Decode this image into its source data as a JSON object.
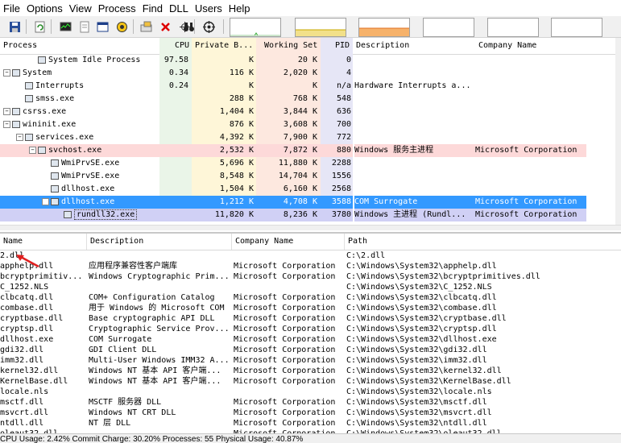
{
  "menu": [
    "File",
    "Options",
    "View",
    "Process",
    "Find",
    "DLL",
    "Users",
    "Help"
  ],
  "toolbar_icons": [
    "save-icon",
    "refresh-icon",
    "system-info-icon",
    "properties-icon",
    "window-icon",
    "cpu-icon",
    "options-icon",
    "kill-icon",
    "crosshair-icon",
    "find-icon",
    "target-icon"
  ],
  "colors": {
    "cpu_bg": "#eaf5e8",
    "private_bg": "#fef6d8",
    "ws_bg": "#fde8df",
    "pid_bg": "#e6e6f6",
    "service_row": "#fdd9d9",
    "selected_row": "#3399ff",
    "own_row": "#d0d0f5"
  },
  "process_columns": {
    "process": "Process",
    "cpu": "CPU",
    "private": "Private B...",
    "ws": "Working Set",
    "pid": "PID",
    "desc": "Description",
    "company": "Company Name"
  },
  "processes": [
    {
      "name": "System Idle Process",
      "cpu": "97.58",
      "private": "K",
      "ws": "20 K",
      "pid": "0",
      "desc": "",
      "company": ""
    },
    {
      "name": "System",
      "cpu": "0.34",
      "private": "116 K",
      "ws": "2,020 K",
      "pid": "4",
      "desc": "",
      "company": ""
    },
    {
      "name": "Interrupts",
      "cpu": "0.24",
      "private": "K",
      "ws": "K",
      "pid": "n/a",
      "desc": "Hardware Interrupts a...",
      "company": ""
    },
    {
      "name": "smss.exe",
      "cpu": "",
      "private": "288 K",
      "ws": "768 K",
      "pid": "548",
      "desc": "",
      "company": ""
    },
    {
      "name": "csrss.exe",
      "cpu": "",
      "private": "1,404 K",
      "ws": "3,844 K",
      "pid": "636",
      "desc": "",
      "company": ""
    },
    {
      "name": "wininit.exe",
      "cpu": "",
      "private": "876 K",
      "ws": "3,608 K",
      "pid": "700",
      "desc": "",
      "company": ""
    },
    {
      "name": "services.exe",
      "cpu": "",
      "private": "4,392 K",
      "ws": "7,900 K",
      "pid": "772",
      "desc": "",
      "company": ""
    },
    {
      "name": "svchost.exe",
      "cpu": "",
      "private": "2,532 K",
      "ws": "7,872 K",
      "pid": "880",
      "desc": "Windows 服务主进程",
      "company": "Microsoft Corporation"
    },
    {
      "name": "WmiPrvSE.exe",
      "cpu": "",
      "private": "5,696 K",
      "ws": "11,880 K",
      "pid": "2288",
      "desc": "",
      "company": ""
    },
    {
      "name": "WmiPrvSE.exe",
      "cpu": "",
      "private": "8,548 K",
      "ws": "14,704 K",
      "pid": "1556",
      "desc": "",
      "company": ""
    },
    {
      "name": "dllhost.exe",
      "cpu": "",
      "private": "1,504 K",
      "ws": "6,160 K",
      "pid": "2568",
      "desc": "",
      "company": ""
    },
    {
      "name": "dllhost.exe",
      "cpu": "",
      "private": "1,212 K",
      "ws": "4,708 K",
      "pid": "3588",
      "desc": "COM Surrogate",
      "company": "Microsoft Corporation"
    },
    {
      "name": "rundll32.exe",
      "cpu": "",
      "private": "11,820 K",
      "ws": "8,236 K",
      "pid": "3780",
      "desc": "Windows 主进程 (Rundl...",
      "company": "Microsoft Corporation"
    }
  ],
  "dll_columns": {
    "name": "Name",
    "desc": "Description",
    "company": "Company Name",
    "path": "Path"
  },
  "dlls": [
    {
      "name": "2.dll",
      "desc": "",
      "company": "",
      "path": "C:\\2.dll"
    },
    {
      "name": "apphelp.dll",
      "desc": "应用程序兼容性客户端库",
      "company": "Microsoft Corporation",
      "path": "C:\\Windows\\System32\\apphelp.dll"
    },
    {
      "name": "bcryptprimitiv...",
      "desc": "Windows Cryptographic Prim...",
      "company": "Microsoft Corporation",
      "path": "C:\\Windows\\System32\\bcryptprimitives.dll"
    },
    {
      "name": "C_1252.NLS",
      "desc": "",
      "company": "",
      "path": "C:\\Windows\\System32\\C_1252.NLS"
    },
    {
      "name": "clbcatq.dll",
      "desc": "COM+ Configuration Catalog",
      "company": "Microsoft Corporation",
      "path": "C:\\Windows\\System32\\clbcatq.dll"
    },
    {
      "name": "combase.dll",
      "desc": "用于 Windows 的 Microsoft COM",
      "company": "Microsoft Corporation",
      "path": "C:\\Windows\\System32\\combase.dll"
    },
    {
      "name": "cryptbase.dll",
      "desc": "Base cryptographic API DLL",
      "company": "Microsoft Corporation",
      "path": "C:\\Windows\\System32\\cryptbase.dll"
    },
    {
      "name": "cryptsp.dll",
      "desc": "Cryptographic Service Prov...",
      "company": "Microsoft Corporation",
      "path": "C:\\Windows\\System32\\cryptsp.dll"
    },
    {
      "name": "dllhost.exe",
      "desc": "COM Surrogate",
      "company": "Microsoft Corporation",
      "path": "C:\\Windows\\System32\\dllhost.exe"
    },
    {
      "name": "gdi32.dll",
      "desc": "GDI Client DLL",
      "company": "Microsoft Corporation",
      "path": "C:\\Windows\\System32\\gdi32.dll"
    },
    {
      "name": "imm32.dll",
      "desc": "Multi-User Windows IMM32 A...",
      "company": "Microsoft Corporation",
      "path": "C:\\Windows\\System32\\imm32.dll"
    },
    {
      "name": "kernel32.dll",
      "desc": "Windows NT 基本 API 客户端...",
      "company": "Microsoft Corporation",
      "path": "C:\\Windows\\System32\\kernel32.dll"
    },
    {
      "name": "KernelBase.dll",
      "desc": "Windows NT 基本 API 客户端...",
      "company": "Microsoft Corporation",
      "path": "C:\\Windows\\System32\\KernelBase.dll"
    },
    {
      "name": "locale.nls",
      "desc": "",
      "company": "",
      "path": "C:\\Windows\\System32\\locale.nls"
    },
    {
      "name": "msctf.dll",
      "desc": "MSCTF 服务器 DLL",
      "company": "Microsoft Corporation",
      "path": "C:\\Windows\\System32\\msctf.dll"
    },
    {
      "name": "msvcrt.dll",
      "desc": "Windows NT CRT DLL",
      "company": "Microsoft Corporation",
      "path": "C:\\Windows\\System32\\msvcrt.dll"
    },
    {
      "name": "ntdll.dll",
      "desc": "NT 层 DLL",
      "company": "Microsoft Corporation",
      "path": "C:\\Windows\\System32\\ntdll.dll"
    },
    {
      "name": "oleaut32.dll",
      "desc": "",
      "company": "Microsoft Corporation",
      "path": "C:\\Windows\\System32\\oleaut32.dll"
    }
  ],
  "status": "CPU Usage: 2.42%    Commit Charge: 30.20%    Processes: 55    Physical Usage: 40.87%"
}
